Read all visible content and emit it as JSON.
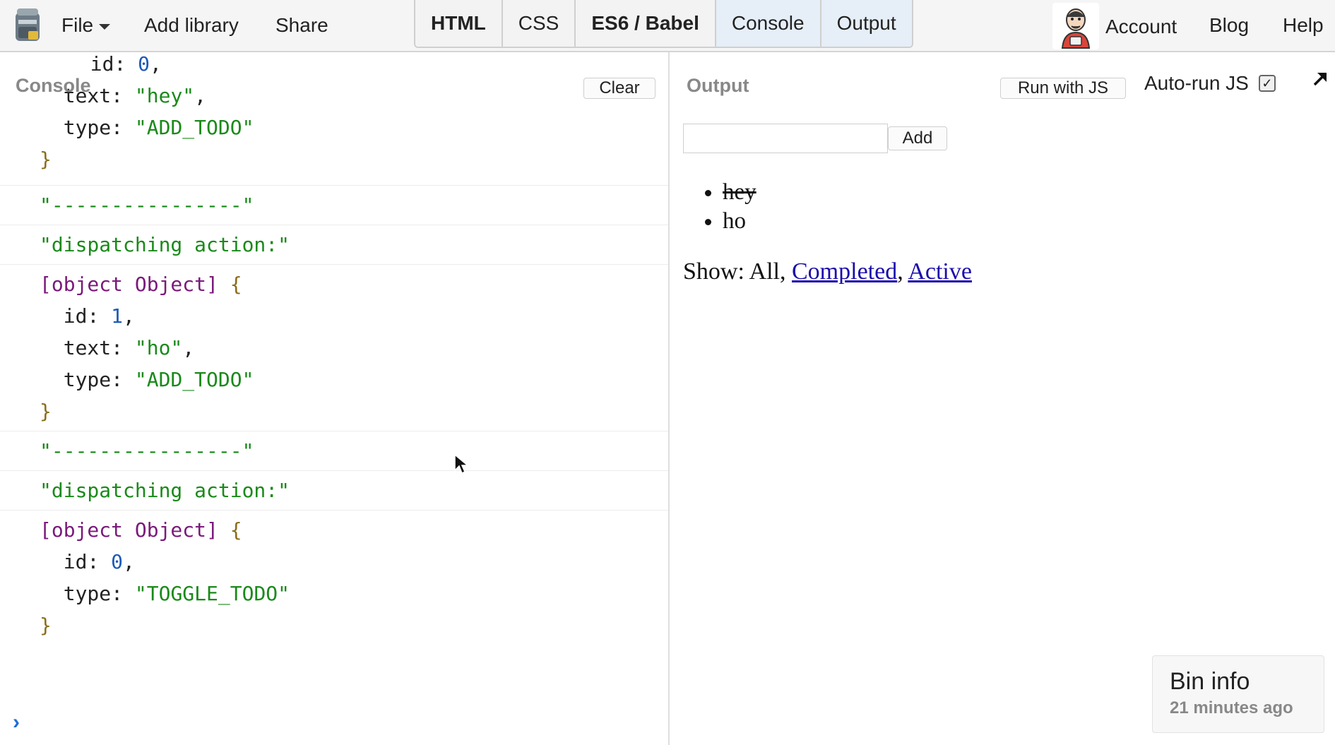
{
  "menu": {
    "file": "File",
    "add_library": "Add library",
    "share": "Share"
  },
  "panel_tabs": [
    {
      "label": "HTML",
      "bold": true,
      "active": false
    },
    {
      "label": "CSS",
      "bold": false,
      "active": false
    },
    {
      "label": "ES6 / Babel",
      "bold": true,
      "active": false
    },
    {
      "label": "Console",
      "bold": false,
      "active": true
    },
    {
      "label": "Output",
      "bold": false,
      "active": true
    }
  ],
  "account_nav": {
    "account": "Account",
    "blog": "Blog",
    "help": "Help"
  },
  "console": {
    "title": "Console",
    "clear_label": "Clear",
    "prompt_symbol": "›",
    "partial_entry": {
      "id_line": [
        "id",
        "0"
      ],
      "text_line": [
        "text",
        "\"hey\""
      ],
      "type_line": [
        "type",
        "\"ADD_TODO\""
      ]
    },
    "entries": [
      {
        "kind": "string",
        "text": "\"----------------\""
      },
      {
        "kind": "string",
        "text": "\"dispatching action:\""
      },
      {
        "kind": "object",
        "head": "[object Object]",
        "fields": [
          [
            "id",
            "1",
            "num"
          ],
          [
            "text",
            "\"ho\"",
            "str"
          ],
          [
            "type",
            "\"ADD_TODO\"",
            "str"
          ]
        ]
      },
      {
        "kind": "string",
        "text": "\"----------------\""
      },
      {
        "kind": "string",
        "text": "\"dispatching action:\""
      },
      {
        "kind": "object",
        "head": "[object Object]",
        "fields": [
          [
            "id",
            "0",
            "num"
          ],
          [
            "type",
            "\"TOGGLE_TODO\"",
            "str"
          ]
        ]
      }
    ]
  },
  "output": {
    "title": "Output",
    "run_label": "Run with JS",
    "autorun_label": "Auto-run JS",
    "autorun_checked": true,
    "input_value": "",
    "add_label": "Add",
    "todos": [
      {
        "text": "hey",
        "completed": true
      },
      {
        "text": "ho",
        "completed": false
      }
    ],
    "filter": {
      "prefix": "Show:",
      "all": "All",
      "completed": "Completed",
      "active": "Active"
    }
  },
  "bin_info": {
    "title": "Bin info",
    "time": "21 minutes ago"
  },
  "colors": {
    "string": "#1a8a1a",
    "number": "#1c5ab8",
    "object": "#7a1a7a",
    "link": "#1a0dab",
    "prompt": "#1f6fd6"
  },
  "icons": {
    "logo": "jsbin-jar-icon",
    "file_caret": "caret-down-icon",
    "avatar": "user-avatar",
    "popout": "popout-arrow-icon",
    "checkbox": "checkmark-icon",
    "cursor": "mouse-pointer-icon"
  }
}
